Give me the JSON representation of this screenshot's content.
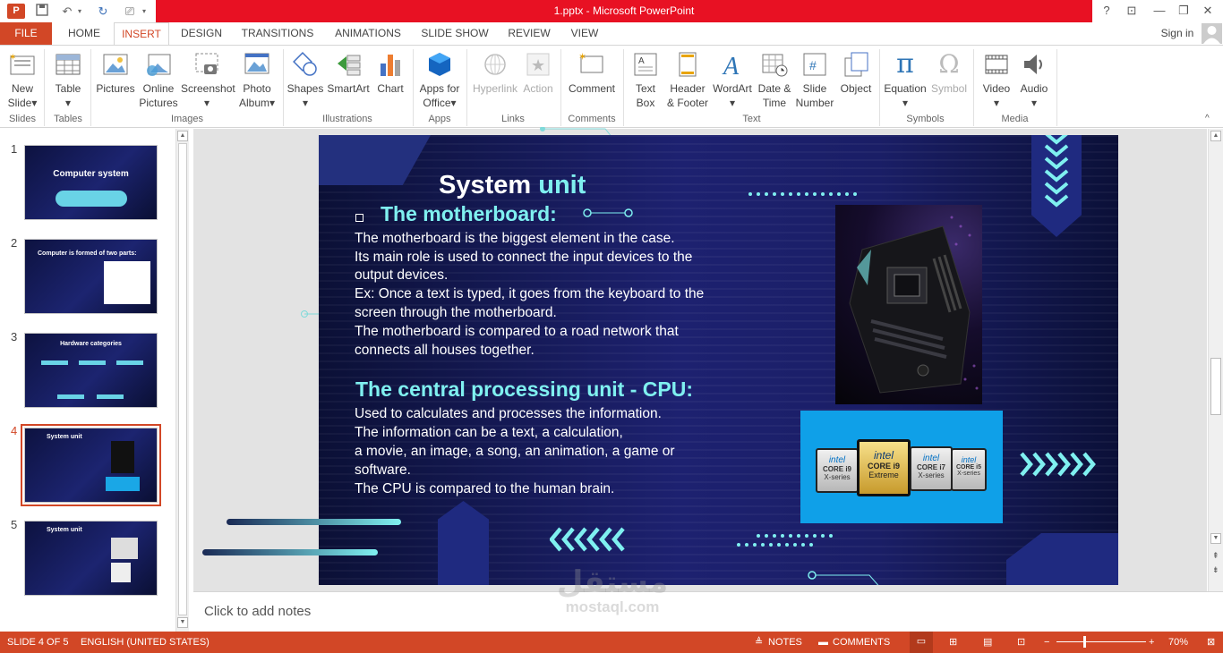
{
  "window": {
    "title": "1.pptx -  Microsoft PowerPoint",
    "user": "Sign in"
  },
  "tabs": [
    "FILE",
    "HOME",
    "INSERT",
    "DESIGN",
    "TRANSITIONS",
    "ANIMATIONS",
    "SLIDE SHOW",
    "REVIEW",
    "VIEW"
  ],
  "active_tab": "INSERT",
  "ribbon": {
    "new_slide": [
      "New",
      "Slide"
    ],
    "table": "Table",
    "pictures": "Pictures",
    "online_pictures": [
      "Online",
      "Pictures"
    ],
    "screenshot": "Screenshot",
    "photo_album": [
      "Photo",
      "Album"
    ],
    "shapes": "Shapes",
    "smartart": "SmartArt",
    "chart": "Chart",
    "apps": [
      "Apps for",
      "Office"
    ],
    "hyperlink": "Hyperlink",
    "action": "Action",
    "comment": "Comment",
    "text_box": [
      "Text",
      "Box"
    ],
    "header_footer": [
      "Header",
      "& Footer"
    ],
    "wordart": "WordArt",
    "date_time": [
      "Date &",
      "Time"
    ],
    "slide_number": [
      "Slide",
      "Number"
    ],
    "object": "Object",
    "equation": "Equation",
    "symbol": "Symbol",
    "video": "Video",
    "audio": "Audio",
    "groups": {
      "slides": "Slides",
      "tables": "Tables",
      "images": "Images",
      "illustrations": "Illustrations",
      "apps": "Apps",
      "links": "Links",
      "comments": "Comments",
      "text": "Text",
      "symbols": "Symbols",
      "media": "Media"
    }
  },
  "thumbnails": [
    {
      "num": "1",
      "title": "Computer system"
    },
    {
      "num": "2",
      "title": "Computer is formed of two parts:"
    },
    {
      "num": "3",
      "title": "Hardware categories"
    },
    {
      "num": "4",
      "title": "System unit"
    },
    {
      "num": "5",
      "title": "System unit"
    }
  ],
  "slide": {
    "title_white": "System",
    "title_cyan": "unit",
    "heading1": "The motherboard:",
    "para1": [
      "The motherboard is the biggest element in the case.",
      "Its main role is used to connect the input devices to the",
      "output devices.",
      "Ex: Once a text is typed, it goes from the keyboard to the",
      "screen through the motherboard.",
      "The motherboard is compared to a road network that",
      "connects all houses together."
    ],
    "heading2": "The central processing unit  - CPU:",
    "para2": [
      "Used to calculates and processes the information.",
      "The information can be a text, a calculation,",
      "a movie, an image, a song, an animation, a game or",
      "software.",
      "The CPU is compared to the human brain."
    ],
    "cpu_badges": [
      {
        "brand": "intel",
        "name": "CORE i9",
        "sub": "X-series"
      },
      {
        "brand": "intel",
        "name": "CORE i9",
        "sub": "Extreme"
      },
      {
        "brand": "intel",
        "name": "CORE i7",
        "sub": "X-series"
      },
      {
        "brand": "intel",
        "name": "CORE i5",
        "sub": "X-series"
      }
    ]
  },
  "notes": {
    "placeholder": "Click to add notes"
  },
  "watermark": {
    "arabic": "مستقل",
    "latin": "mostaql.com"
  },
  "status": {
    "slide": "SLIDE 4 OF 5",
    "language": "ENGLISH (UNITED STATES)",
    "notes": "NOTES",
    "comments": "COMMENTS",
    "zoom": "70%"
  },
  "colors": {
    "accent": "#d24726",
    "title_red": "#e81123",
    "slide_cyan": "#7ff0f0"
  }
}
